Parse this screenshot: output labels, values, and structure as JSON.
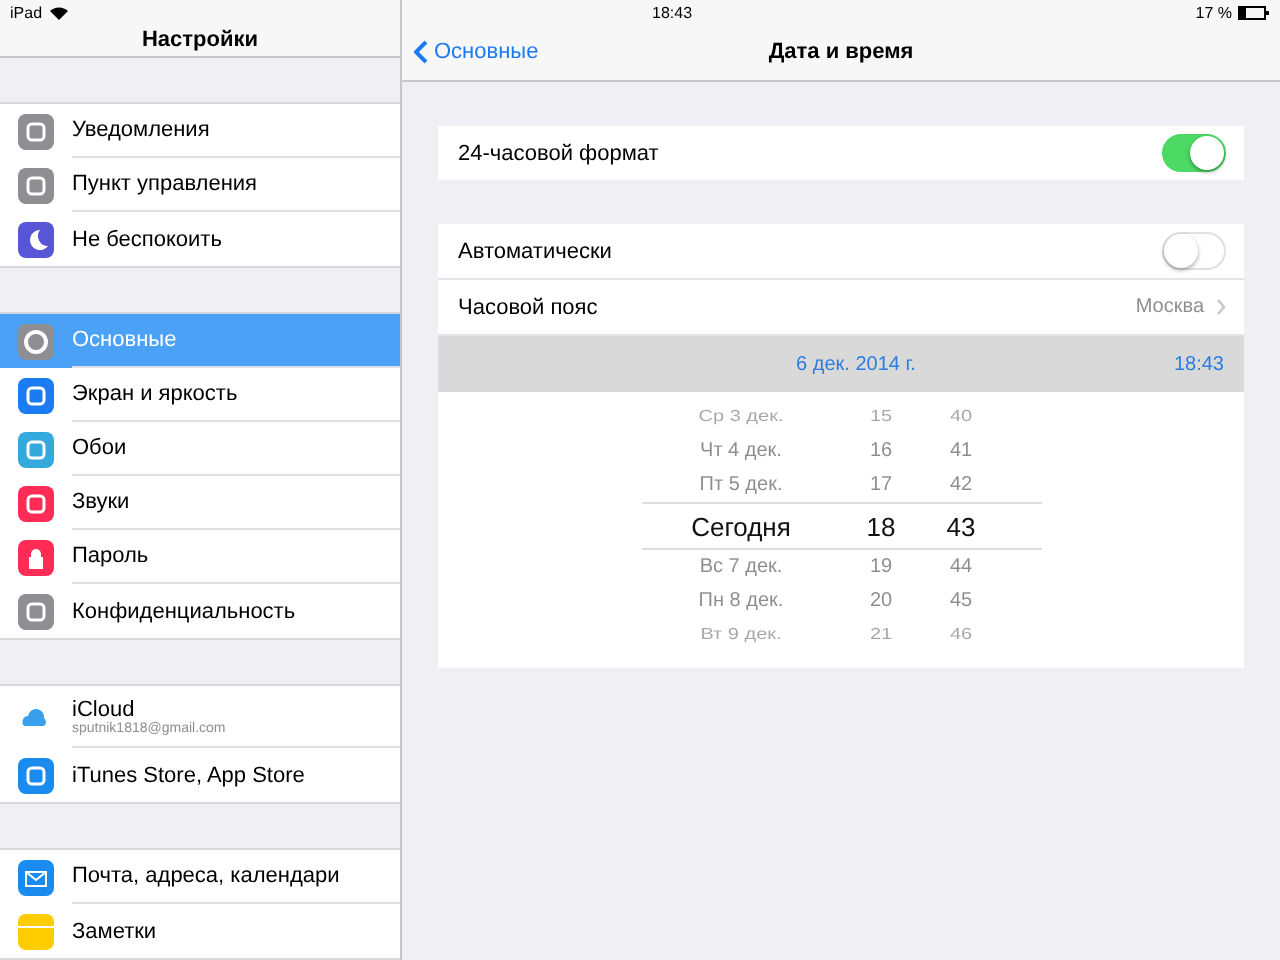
{
  "status_bar": {
    "device": "iPad",
    "time": "18:43",
    "battery": "17 %"
  },
  "sidebar": {
    "title": "Настройки",
    "groups": [
      [
        {
          "label": "Уведомления",
          "selected": false
        },
        {
          "label": "Пункт управления",
          "selected": false
        },
        {
          "label": "Не беспокоить",
          "selected": false
        }
      ],
      [
        {
          "label": "Основные",
          "selected": true
        },
        {
          "label": "Экран и яркость",
          "selected": false
        },
        {
          "label": "Обои",
          "selected": false
        },
        {
          "label": "Звуки",
          "selected": false
        },
        {
          "label": "Пароль",
          "selected": false
        },
        {
          "label": "Конфиденциальность",
          "selected": false
        }
      ],
      [
        {
          "label": "iCloud",
          "subtitle": "sputnik1818@gmail.com",
          "selected": false
        },
        {
          "label": "iTunes Store, App Store",
          "selected": false
        }
      ],
      [
        {
          "label": "Почта, адреса, календари",
          "selected": false
        },
        {
          "label": "Заметки",
          "selected": false
        }
      ]
    ]
  },
  "nav": {
    "back": "Основные",
    "title": "Дата и время"
  },
  "format_24h": {
    "label": "24-часовой формат",
    "on": true
  },
  "automatic": {
    "label": "Автоматически",
    "on": false
  },
  "timezone": {
    "label": "Часовой пояс",
    "value": "Москва"
  },
  "current": {
    "date": "6 дек. 2014 г.",
    "time": "18:43"
  },
  "picker": [
    {
      "day": "Ср 3 дек.",
      "hour": "15",
      "minute": "40",
      "selected": false
    },
    {
      "day": "Чт 4 дек.",
      "hour": "16",
      "minute": "41",
      "selected": false
    },
    {
      "day": "Пт 5 дек.",
      "hour": "17",
      "minute": "42",
      "selected": false
    },
    {
      "day": "Сегодня",
      "hour": "18",
      "minute": "43",
      "selected": true
    },
    {
      "day": "Вс 7 дек.",
      "hour": "19",
      "minute": "44",
      "selected": false
    },
    {
      "day": "Пн 8 дек.",
      "hour": "20",
      "minute": "45",
      "selected": false
    },
    {
      "day": "Вт 9 дек.",
      "hour": "21",
      "minute": "46",
      "selected": false
    }
  ]
}
